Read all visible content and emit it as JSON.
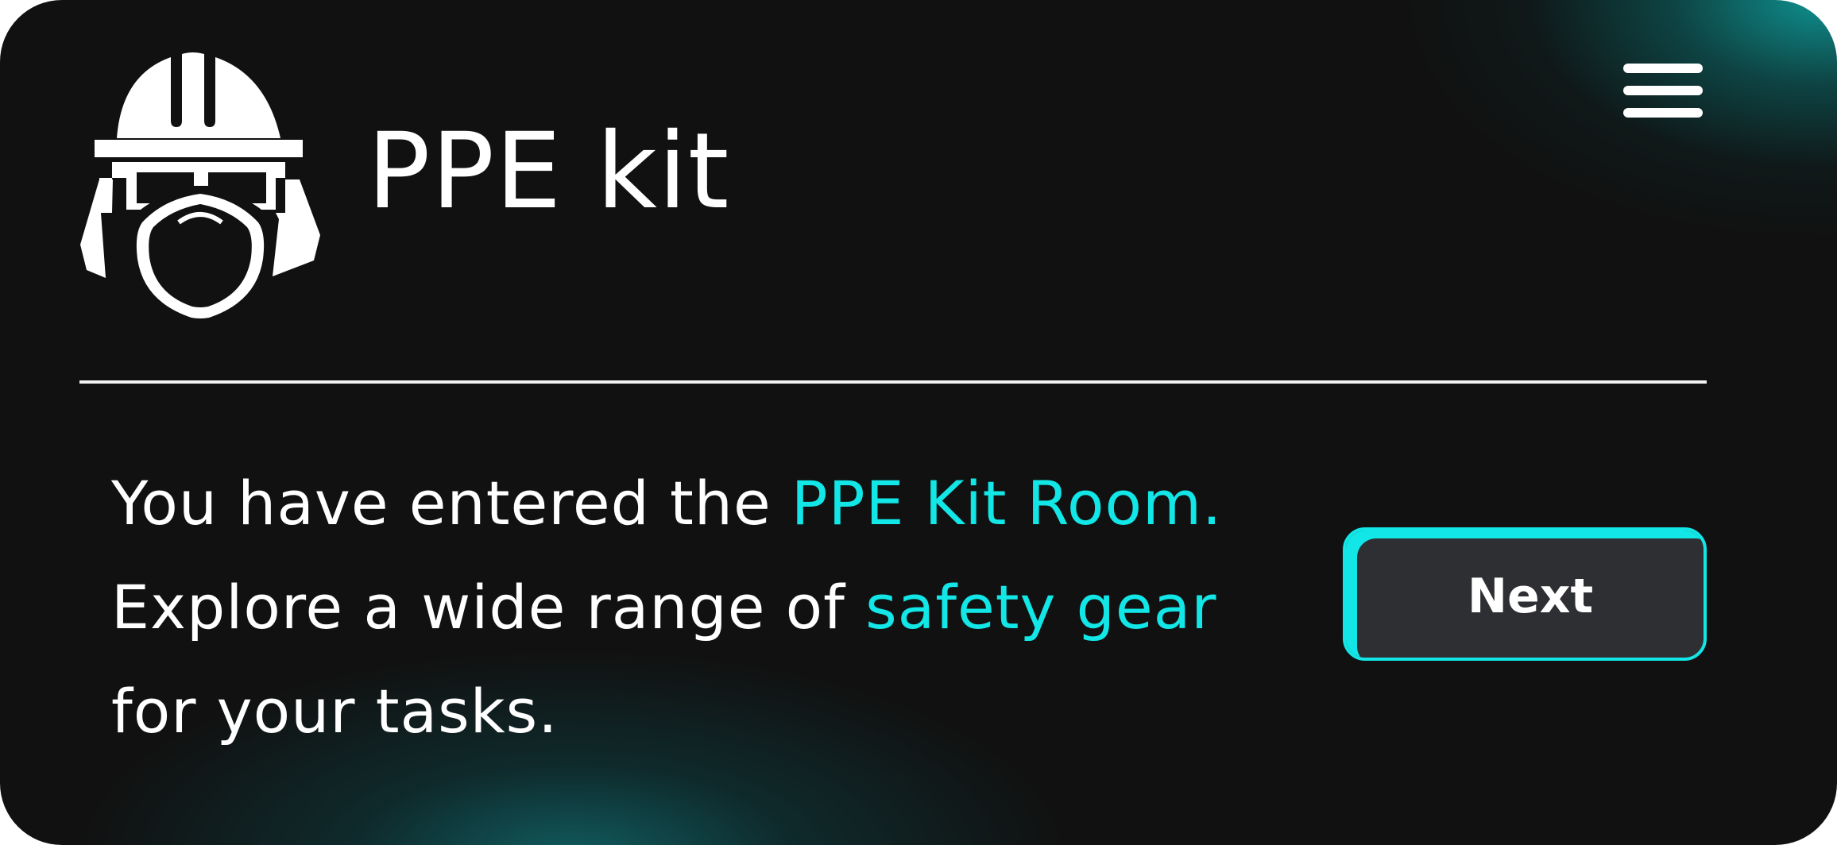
{
  "header": {
    "logo_icon": "worker-hardhat-goggles-mask-icon",
    "title": "PPE kit",
    "menu_icon": "hamburger-menu-icon"
  },
  "message": {
    "line1_prefix": "You have entered the ",
    "line1_highlight": "PPE Kit Room.",
    "line2_prefix": "Explore a wide range of ",
    "line2_highlight": "safety gear",
    "line3": "for your tasks."
  },
  "actions": {
    "next_label": "Next"
  },
  "colors": {
    "background": "#111111",
    "accent": "#12e6e6",
    "text": "#ffffff",
    "button_fill": "#2e2f33"
  }
}
